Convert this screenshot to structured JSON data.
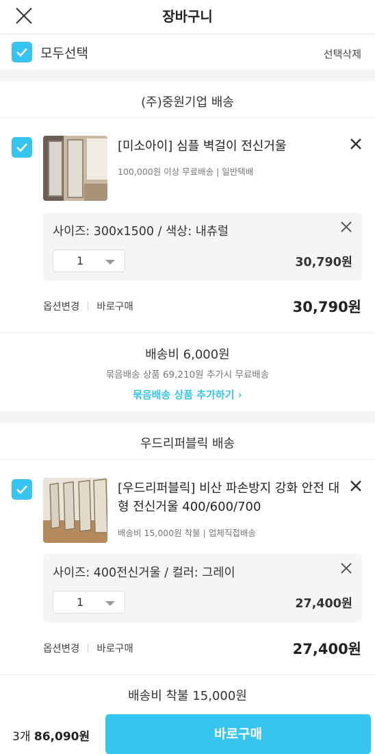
{
  "header": {
    "title": "장바구니",
    "close_icon": "close-icon"
  },
  "selectbar": {
    "select_all_label": "모두선택",
    "delete_selected_label": "선택삭제",
    "checked": true
  },
  "accent_color": "#35c5f0",
  "vendors": [
    {
      "name": "(주)중원기업 배송",
      "item": {
        "name": "[미소아이] 심플 벽걸이 전신거울",
        "meta": "100,000원 이상 무료배송 | 일반택배",
        "option": "사이즈: 300x1500 / 색상: 내츄럴",
        "quantity": "1",
        "option_price": "30,790원",
        "change_option_label": "옵션변경",
        "buy_now_label": "바로구매",
        "total": "30,790원"
      },
      "shipping": {
        "fee": "배송비 6,000원",
        "note": "묶음배송 상품 69,210원 추가시 무료배송",
        "link": "묶음배송 상품 추가하기 ›"
      }
    },
    {
      "name": "우드리퍼블릭 배송",
      "item": {
        "name": "[우드리퍼블릭] 비산 파손방지 강화 안전 대형 전신거울 400/600/700",
        "meta": "배송비 15,000원 착불 | 업체직접배송",
        "option": "사이즈: 400전신거울 / 컬러: 그레이",
        "quantity": "1",
        "option_price": "27,400원",
        "change_option_label": "옵션변경",
        "buy_now_label": "바로구매",
        "total": "27,400원"
      },
      "shipping": {
        "fee": "배송비 착불 15,000원"
      }
    }
  ],
  "footer": {
    "count": "3개",
    "total": "86,090원",
    "buy_label": "바로구매"
  }
}
